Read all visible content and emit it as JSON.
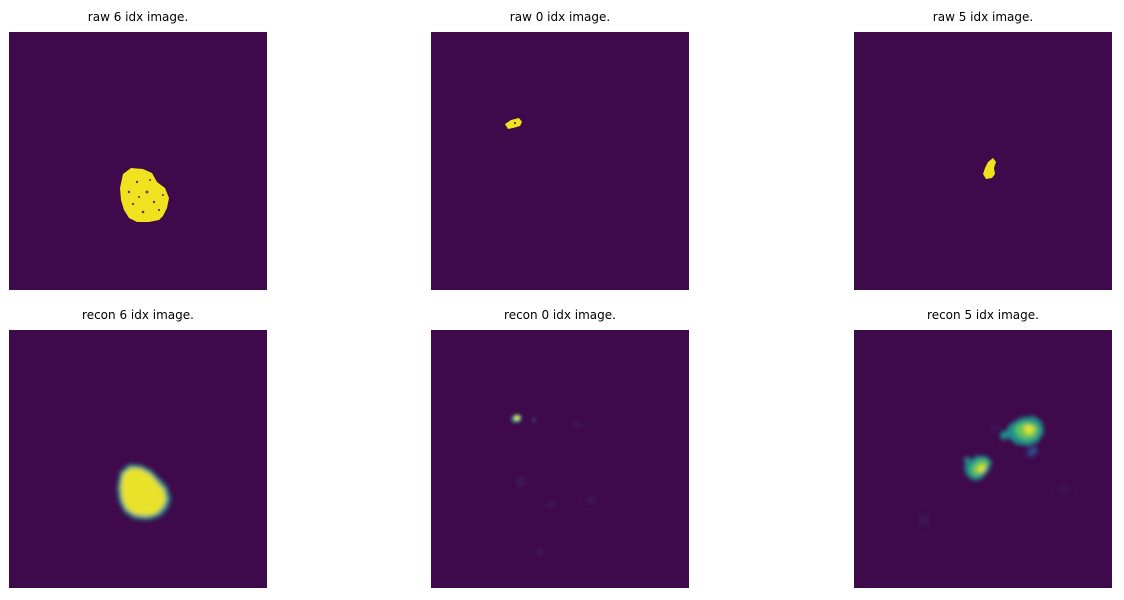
{
  "figure": {
    "background": "#ffffff",
    "image_background_color": "#3f0a4b",
    "highlight_colors": {
      "yellow": "#f4e61e",
      "green": "#3fbf74",
      "teal": "#1f8f8b",
      "blue": "#2f4f8f"
    },
    "rows": [
      {
        "name": "raw",
        "panels": [
          {
            "title": "raw 6 idx image."
          },
          {
            "title": "raw 0 idx image."
          },
          {
            "title": "raw 5 idx image."
          }
        ]
      },
      {
        "name": "recon",
        "panels": [
          {
            "title": "recon 6 idx image."
          },
          {
            "title": "recon 0 idx image."
          },
          {
            "title": "recon 5 idx image."
          }
        ]
      }
    ]
  }
}
